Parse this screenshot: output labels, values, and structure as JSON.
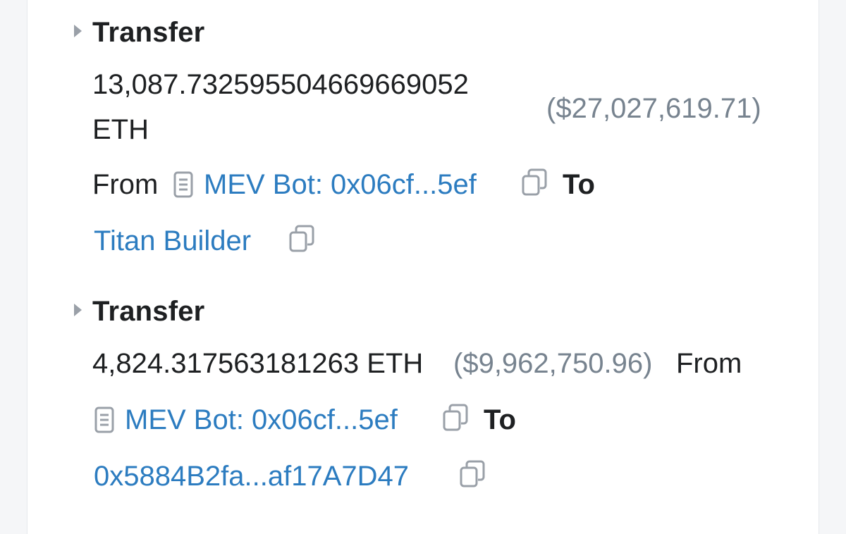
{
  "transfers": [
    {
      "heading": "Transfer",
      "amount_line1": "13,087.732595504669669052",
      "amount_line2": "ETH",
      "usd": "($27,027,619.71)",
      "from_label": "From",
      "from_name": "MEV Bot: 0x06cf...5ef",
      "to_label": "To",
      "to_name": "Titan Builder"
    },
    {
      "heading": "Transfer",
      "amount": "4,824.317563181263 ETH",
      "usd": "($9,962,750.96)",
      "from_label": "From",
      "from_name": "MEV Bot: 0x06cf...5ef",
      "to_label": "To",
      "to_name": "0x5884B2fa...af17A7D47"
    }
  ],
  "icons": {
    "caret": "caret-right-icon",
    "contract": "contract-document-icon",
    "copy": "copy-icon"
  },
  "colors": {
    "link": "#2c7cc0",
    "text": "#1e2022",
    "muted": "#77838f",
    "icon": "#9aa0a8"
  }
}
